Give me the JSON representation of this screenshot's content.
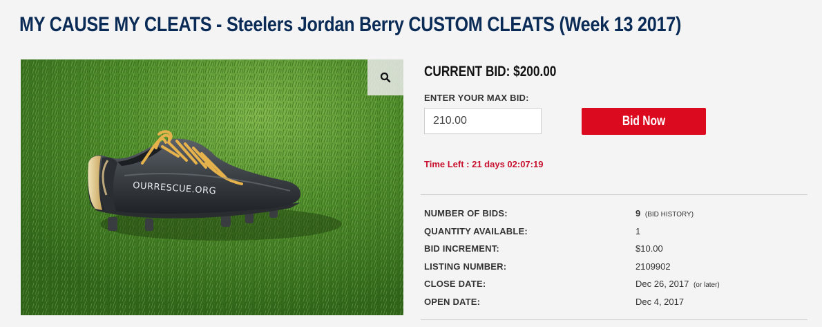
{
  "page": {
    "title": "MY CAUSE MY CLEATS - Steelers Jordan Berry CUSTOM CLEATS (Week 13 2017)"
  },
  "image": {
    "cleat_text": "OURRESCUE.ORG",
    "zoom_icon": "magnifier-icon"
  },
  "bid": {
    "current_label": "CURRENT BID: $200.00",
    "max_bid_label": "ENTER YOUR MAX BID:",
    "max_bid_value": "210.00",
    "button_label": "Bid Now",
    "time_left": "Time Left : 21 days 02:07:19"
  },
  "details": {
    "number_of_bids": {
      "label": "NUMBER OF BIDS:",
      "value": "9",
      "link": "(BID HISTORY)"
    },
    "quantity_available": {
      "label": "QUANTITY AVAILABLE:",
      "value": "1"
    },
    "bid_increment": {
      "label": "BID INCREMENT:",
      "value": "$10.00"
    },
    "listing_number": {
      "label": "LISTING NUMBER:",
      "value": "2109902"
    },
    "close_date": {
      "label": "CLOSE DATE:",
      "value": "Dec 26, 2017",
      "note": "(or later)"
    },
    "open_date": {
      "label": "OPEN DATE:",
      "value": "Dec 4, 2017"
    }
  },
  "colors": {
    "title": "#0b2b57",
    "button": "#dc0a1e",
    "time_left": "#c8102e",
    "background": "#f4f4f4"
  }
}
